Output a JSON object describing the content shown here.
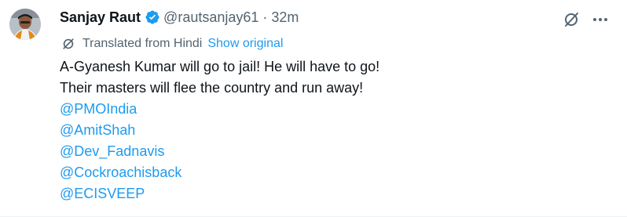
{
  "author": {
    "name": "Sanjay Raut",
    "handle": "@rautsanjay61",
    "separator": "·",
    "time": "32m"
  },
  "translation": {
    "label": "Translated from Hindi",
    "show_original": "Show original"
  },
  "text": {
    "line1": "A-Gyanesh Kumar will go to jail! He will have to go!",
    "line2": "Their masters will flee the country and run away!"
  },
  "mentions": [
    "@PMOIndia",
    "@AmitShah",
    "@Dev_Fadnavis",
    "@Cockroachisback",
    "@ECISVEEP"
  ],
  "icons": {
    "verified": "verified-badge-icon",
    "grok": "grok-icon",
    "more": "more-options-icon",
    "translate": "translate-icon"
  },
  "colors": {
    "link": "#1d9bf0",
    "secondary": "#536471",
    "text": "#0f1419"
  }
}
